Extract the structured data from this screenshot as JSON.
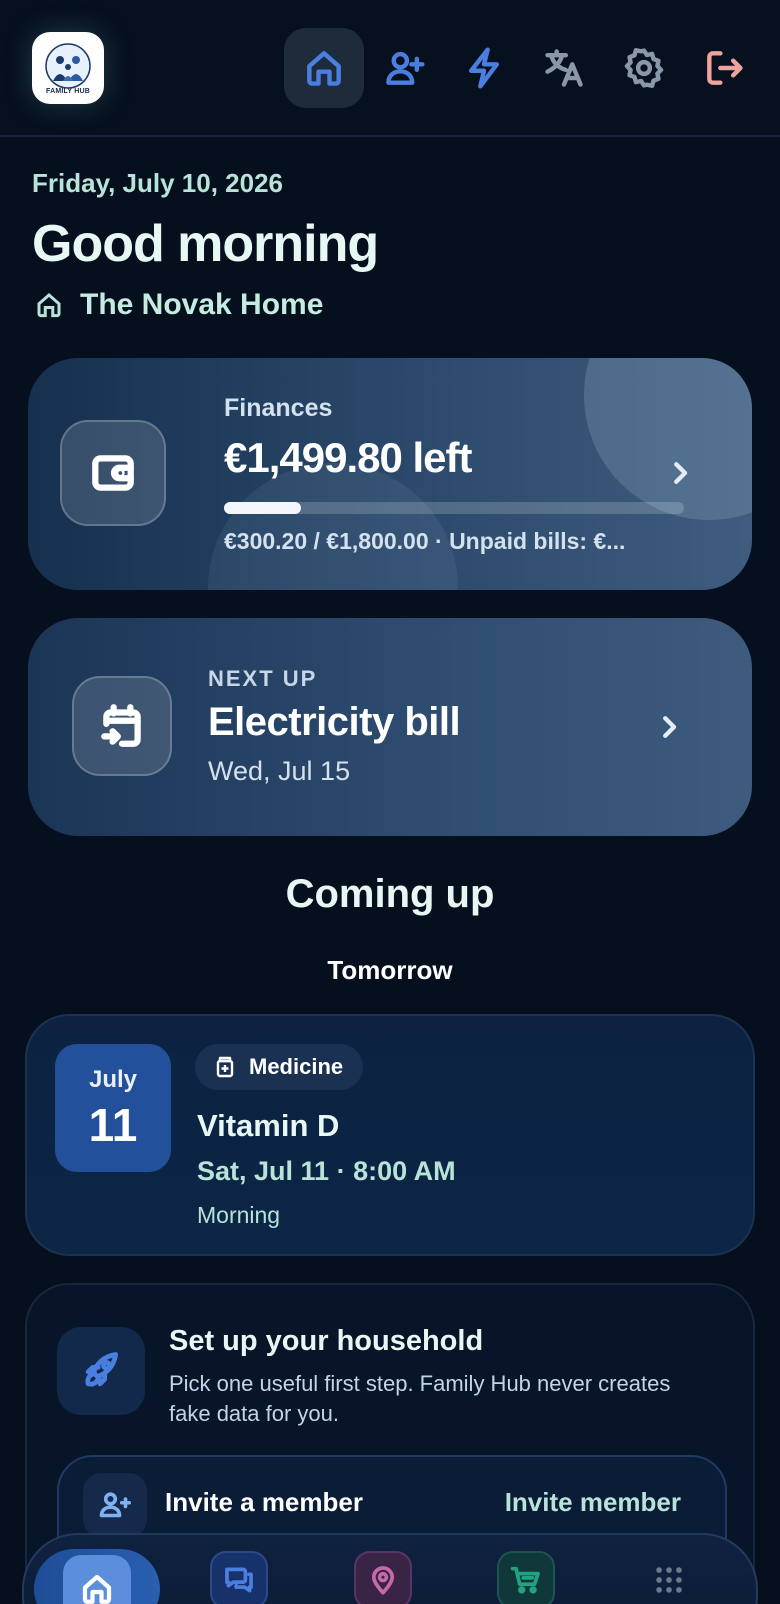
{
  "app": {
    "logo_text": "FAMILY HUB"
  },
  "topnav": {
    "items": [
      {
        "name": "home-icon",
        "color": "#4a7fe0",
        "active": true
      },
      {
        "name": "add-user-icon",
        "color": "#4a7fe0"
      },
      {
        "name": "lightning-icon",
        "color": "#4a7fe0"
      },
      {
        "name": "translate-icon",
        "color": "#8a97a8"
      },
      {
        "name": "gear-icon",
        "color": "#8a97a8"
      },
      {
        "name": "logout-icon",
        "color": "#f0a39b"
      }
    ]
  },
  "header": {
    "date": "Friday, July 10, 2026",
    "greeting": "Good morning",
    "home_name": "The Novak Home"
  },
  "finances": {
    "label": "Finances",
    "amount_left": "€1,499.80 left",
    "progress_fraction": 0.1668,
    "summary": "€300.20 / €1,800.00 · Unpaid bills: €..."
  },
  "next_up": {
    "kicker": "NEXT UP",
    "title": "Electricity bill",
    "date": "Wed, Jul 15"
  },
  "coming_up": {
    "title": "Coming up",
    "group_label": "Tomorrow",
    "event": {
      "month": "July",
      "day": "11",
      "category": "Medicine",
      "title": "Vitamin D",
      "time": "Sat, Jul 11 · 8:00 AM",
      "note": "Morning"
    }
  },
  "setup": {
    "title": "Set up your household",
    "description": "Pick one useful first step. Family Hub never creates fake data for you.",
    "step_label": "Invite a member",
    "step_action": "Invite member"
  },
  "bottom_nav": {
    "items": [
      {
        "name": "home-icon",
        "active": true
      },
      {
        "name": "chat-icon",
        "color": "#4a7fe0"
      },
      {
        "name": "location-pin-icon",
        "color": "#c46aa8"
      },
      {
        "name": "cart-icon",
        "color": "#23a27f"
      },
      {
        "name": "apps-grid-icon",
        "color": "#6e7a8c"
      }
    ]
  }
}
